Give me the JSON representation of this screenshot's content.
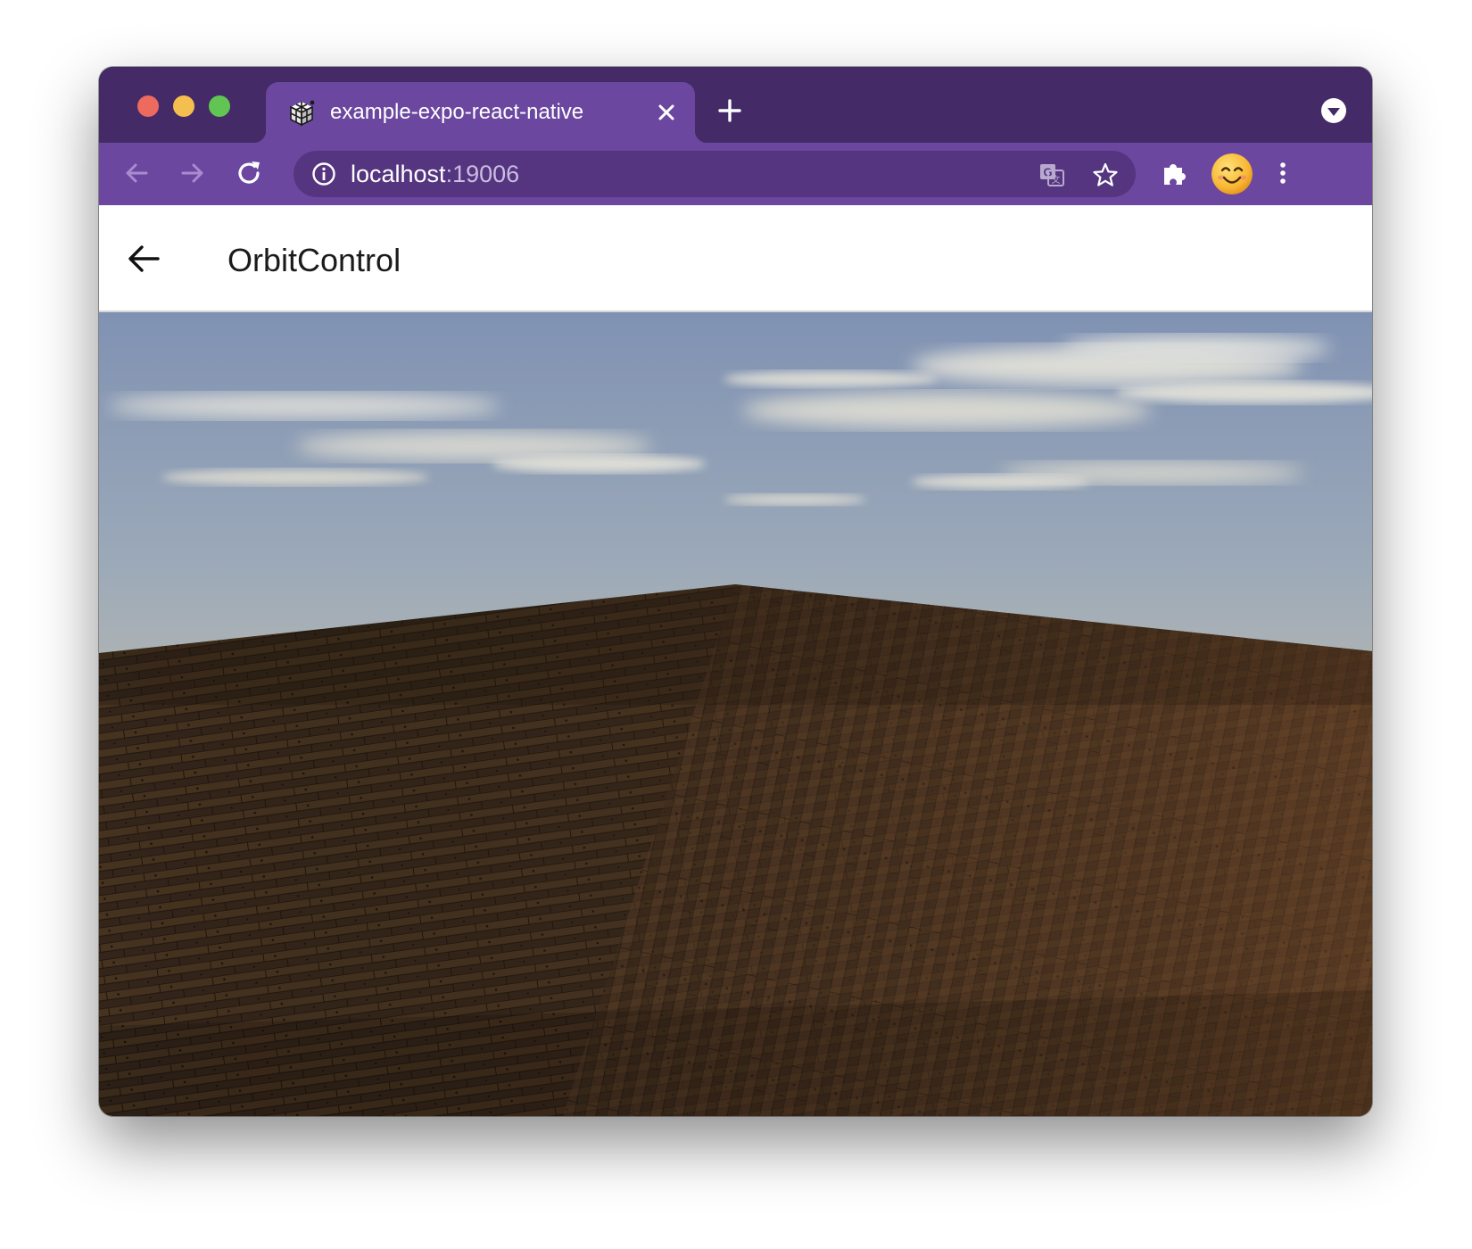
{
  "browser": {
    "tab": {
      "title": "example-expo-react-native",
      "favicon": "expo-cube-icon",
      "close_icon": "close-icon"
    },
    "new_tab_icon": "plus-icon",
    "tab_search_icon": "chevron-down-circle-icon",
    "nav": {
      "back_icon": "arrow-left-icon",
      "forward_icon": "arrow-right-icon",
      "reload_icon": "reload-icon"
    },
    "address": {
      "host": "localhost",
      "port": ":19006",
      "info_icon": "info-icon",
      "translate_icon": "translate-icon",
      "bookmark_icon": "star-icon"
    },
    "extensions_icon": "puzzle-icon",
    "profile_icon": "smiley-avatar",
    "menu_icon": "kebab-menu-icon"
  },
  "app": {
    "header": {
      "back_icon": "arrow-left-icon",
      "title": "OrbitControl"
    },
    "scene": {
      "description_colors": {
        "sky_top": "#8497b5",
        "horizon": "#d8cfbb",
        "floor": "#3a2a1c"
      }
    }
  },
  "colors": {
    "tabbar": "#442a66",
    "toolbar": "#6b47a0",
    "omnibox": "#553580"
  }
}
